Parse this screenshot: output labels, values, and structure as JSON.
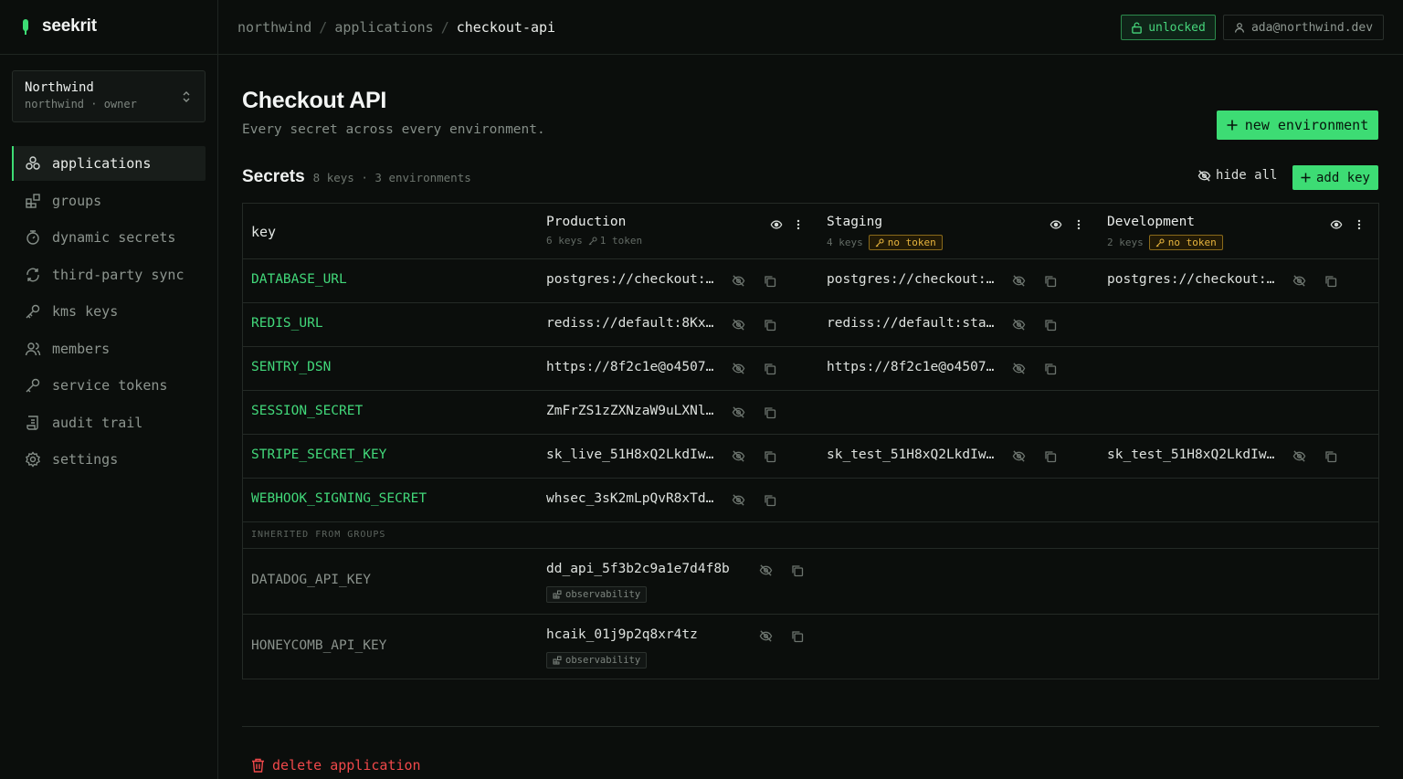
{
  "brand": {
    "name": "seekrit",
    "accent": "#3ddc74"
  },
  "workspace": {
    "name": "Northwind",
    "sub": "northwind · owner"
  },
  "nav": {
    "items": [
      {
        "label": "applications",
        "icon": "apps-icon",
        "active": true
      },
      {
        "label": "groups",
        "icon": "groups-icon"
      },
      {
        "label": "dynamic secrets",
        "icon": "dynamic-secrets-icon"
      },
      {
        "label": "third-party sync",
        "icon": "sync-icon"
      },
      {
        "label": "kms keys",
        "icon": "key-icon"
      },
      {
        "label": "members",
        "icon": "members-icon"
      },
      {
        "label": "service tokens",
        "icon": "token-icon"
      },
      {
        "label": "audit trail",
        "icon": "scroll-icon"
      },
      {
        "label": "settings",
        "icon": "gear-icon"
      }
    ]
  },
  "topbar": {
    "breadcrumb": [
      "northwind",
      "applications",
      "checkout-api"
    ],
    "separator": "/",
    "lock_status": "unlocked",
    "user": "ada@northwind.dev"
  },
  "page": {
    "title": "Checkout API",
    "subtitle": "Every secret across every environment.",
    "new_env_label": "new environment"
  },
  "secrets": {
    "title": "Secrets",
    "meta": "8 keys · 3 environments",
    "hide_all_label": "hide all",
    "add_key_label": "add key",
    "key_header": "key",
    "environments": [
      {
        "name": "Production",
        "keys": "6 keys",
        "token": "1 token",
        "has_token": true
      },
      {
        "name": "Staging",
        "keys": "4 keys",
        "token": "no token",
        "has_token": false
      },
      {
        "name": "Development",
        "keys": "2 keys",
        "token": "no token",
        "has_token": false
      }
    ],
    "rows": [
      {
        "key": "DATABASE_URL",
        "values": [
          "postgres://checkout:…",
          "postgres://checkout:…",
          "postgres://checkout:…"
        ]
      },
      {
        "key": "REDIS_URL",
        "values": [
          "rediss://default:8Kx…",
          "rediss://default:sta…",
          ""
        ]
      },
      {
        "key": "SENTRY_DSN",
        "values": [
          "https://8f2c1e@o4507…",
          "https://8f2c1e@o4507…",
          ""
        ]
      },
      {
        "key": "SESSION_SECRET",
        "values": [
          "ZmFrZS1zZXNzaW9uLXNl…",
          "",
          ""
        ]
      },
      {
        "key": "STRIPE_SECRET_KEY",
        "values": [
          "sk_live_51H8xQ2LkdIw…",
          "sk_test_51H8xQ2LkdIw…",
          "sk_test_51H8xQ2LkdIw…"
        ]
      },
      {
        "key": "WEBHOOK_SIGNING_SECRET",
        "values": [
          "whsec_3sK2mLpQvR8xTd…",
          "",
          ""
        ]
      }
    ],
    "inherited_label": "INHERITED FROM GROUPS",
    "inherited": [
      {
        "key": "DATADOG_API_KEY",
        "value": "dd_api_5f3b2c9a1e7d4f8b",
        "group": "observability"
      },
      {
        "key": "HONEYCOMB_API_KEY",
        "value": "hcaik_01j9p2q8xr4tz",
        "group": "observability"
      }
    ]
  },
  "danger": {
    "delete_label": "delete application",
    "color": "#f0484a"
  }
}
